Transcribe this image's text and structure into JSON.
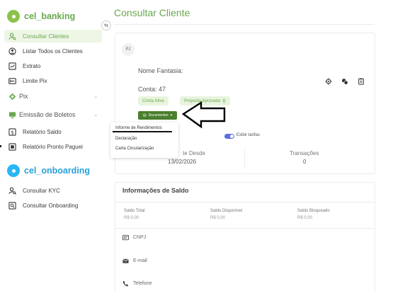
{
  "sidebar": {
    "brand_banking": "cel_banking",
    "brand_onboarding": "cel_onboarding",
    "items": [
      {
        "label": "Consultar Clientes",
        "icon": "user-search-icon",
        "active": true
      },
      {
        "label": "Listar Todos os Clientes",
        "icon": "user-circle-icon",
        "active": false
      },
      {
        "label": "Extrato",
        "icon": "chart-doc-icon",
        "active": false
      },
      {
        "label": "Limite Pix",
        "icon": "limit-icon",
        "active": false
      }
    ],
    "sections": [
      {
        "label": "Pix",
        "icon": "pix-icon"
      },
      {
        "label": "Emissão de Boletos",
        "icon": "monitor-icon"
      }
    ],
    "boleto_items": [
      {
        "label": "Relatório Saldo",
        "icon": "dollar-doc-icon"
      },
      {
        "label": "Relatório Pronto Paguei",
        "icon": "doc-icon"
      }
    ],
    "onboarding_items": [
      {
        "label": "Consultar KYC",
        "icon": "user-search-icon"
      },
      {
        "label": "Consultar Onboarding",
        "icon": "doc-search-icon"
      }
    ]
  },
  "main": {
    "title": "Consultar Cliente",
    "client": {
      "badge": "PJ",
      "nome_fantasia_label": "Nome Fantasia:",
      "conta_label": "Conta: 47",
      "tag_ativa": "Conta Ativa",
      "tag_aprovada": "Proposta Aprovada",
      "docs_button": "Documentos",
      "toggle_label": "Exibir tarifas"
    },
    "dropdown": {
      "items": [
        "Informe de Rendimentos",
        "Declaração",
        "Carta Circularização"
      ]
    },
    "stats": {
      "cliente_desde_label": "te Desde",
      "cliente_desde_value": "13/02/2026",
      "transacoes_label": "Transações",
      "transacoes_value": "0"
    },
    "saldo": {
      "title": "Informações de Saldo",
      "cols": [
        {
          "label": "Saldo Total",
          "value": "R$ 0,00"
        },
        {
          "label": "Saldo Disponível",
          "value": "R$ 0,00"
        },
        {
          "label": "Saldo Bloqueado",
          "value": "R$ 0,00"
        }
      ]
    },
    "info_rows": [
      {
        "label": "CNPJ",
        "icon": "id-card-icon"
      },
      {
        "label": "E-mail",
        "icon": "mail-icon"
      },
      {
        "label": "Telefone",
        "icon": "phone-icon"
      }
    ]
  },
  "colors": {
    "accent": "#6aa84f",
    "accent_dark": "#4a7f2e",
    "tag_bg": "#e8f4de",
    "onboarding": "#29a0d8",
    "toggle": "#5b6ee8"
  }
}
